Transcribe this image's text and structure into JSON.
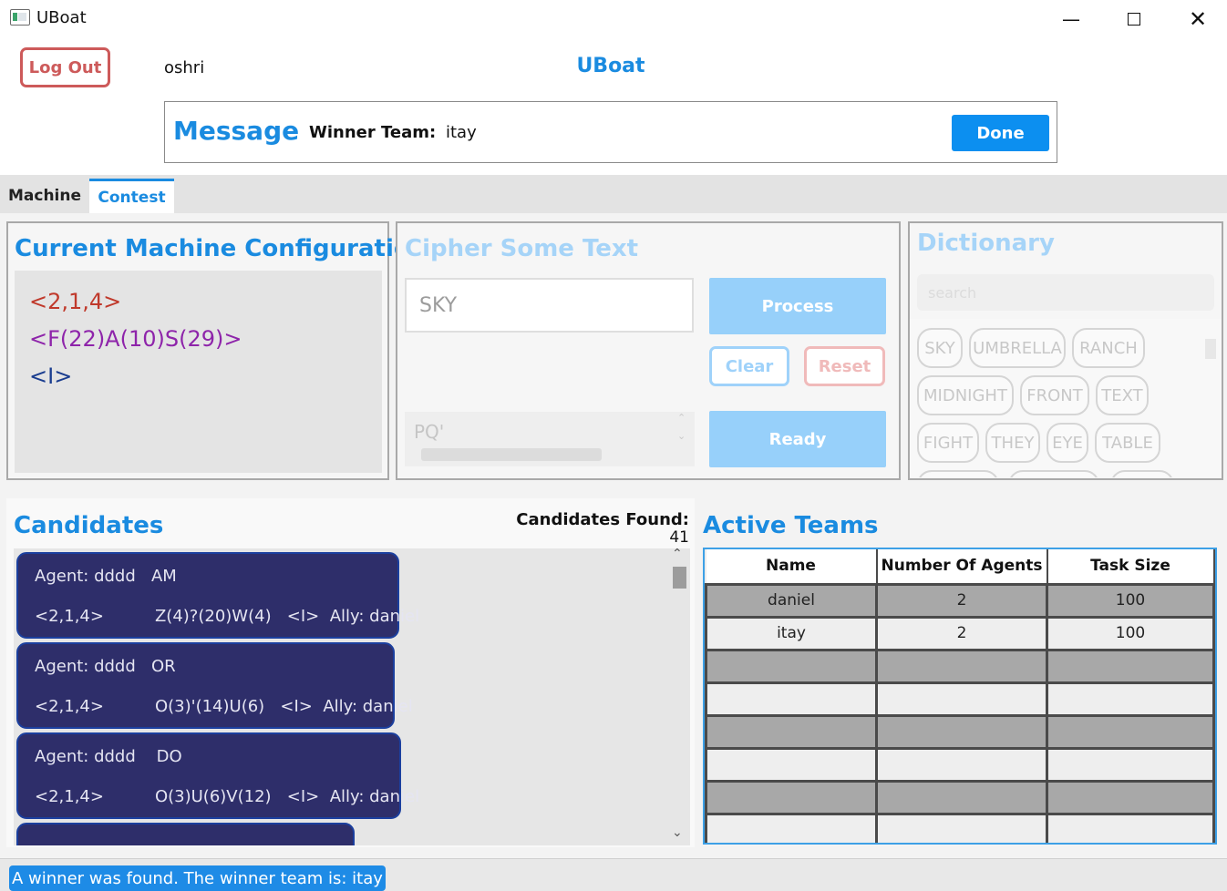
{
  "window": {
    "title": "UBoat"
  },
  "header": {
    "logout_label": "Log Out",
    "username": "oshri",
    "app_heading": "UBoat"
  },
  "message": {
    "title": "Message",
    "winner_label": "Winner Team:",
    "winner_value": "itay",
    "done_label": "Done"
  },
  "tabs": [
    {
      "label": "Machine"
    },
    {
      "label": "Contest"
    }
  ],
  "config": {
    "title": "Current Machine Configuration",
    "rotors": "<2,1,4>",
    "positions": "<F(22)A(10)S(29)>",
    "reflector": "<I>",
    "colors": {
      "rotors": "#c0392b",
      "positions": "#8e24aa",
      "reflector": "#1a3d8f"
    }
  },
  "cipher": {
    "title": "Cipher Some Text",
    "input_value": "SKY",
    "process_label": "Process",
    "clear_label": "Clear",
    "reset_label": "Reset",
    "output_value": "PQ'",
    "ready_label": "Ready"
  },
  "dictionary": {
    "title": "Dictionary",
    "search_placeholder": "search",
    "words": [
      [
        "SKY",
        "UMBRELLA",
        "RANCH"
      ],
      [
        "MIDNIGHT",
        "FRONT",
        "TEXT"
      ],
      [
        "FIGHT",
        "THEY",
        "EYE",
        "TABLE"
      ]
    ]
  },
  "candidates": {
    "title": "Candidates",
    "found_label": "Candidates Found:",
    "found_count": "41",
    "items": [
      {
        "agent": "Agent: dddd",
        "word": "AM",
        "rotors": "<2,1,4>",
        "positions": "Z(4)?(20)W(4)",
        "reflector": "<I>",
        "ally": "Ally: daniel"
      },
      {
        "agent": "Agent: dddd",
        "word": "OR",
        "rotors": "<2,1,4>",
        "positions": "O(3)'(14)U(6)",
        "reflector": "<I>",
        "ally": "Ally: daniel"
      },
      {
        "agent": "Agent: dddd",
        "word": "DO",
        "rotors": "<2,1,4>",
        "positions": "O(3)U(6)V(12)",
        "reflector": "<I>",
        "ally": "Ally: daniel"
      }
    ]
  },
  "teams": {
    "title": "Active Teams",
    "columns": [
      "Name",
      "Number Of Agents",
      "Task Size"
    ],
    "rows": [
      [
        "daniel",
        "2",
        "100"
      ],
      [
        "itay",
        "2",
        "100"
      ],
      [
        "",
        "",
        ""
      ],
      [
        "",
        "",
        ""
      ],
      [
        "",
        "",
        ""
      ],
      [
        "",
        "",
        ""
      ],
      [
        "",
        "",
        ""
      ],
      [
        "",
        "",
        ""
      ]
    ]
  },
  "status": {
    "text": "A winner was found. The winner team is: itay"
  }
}
